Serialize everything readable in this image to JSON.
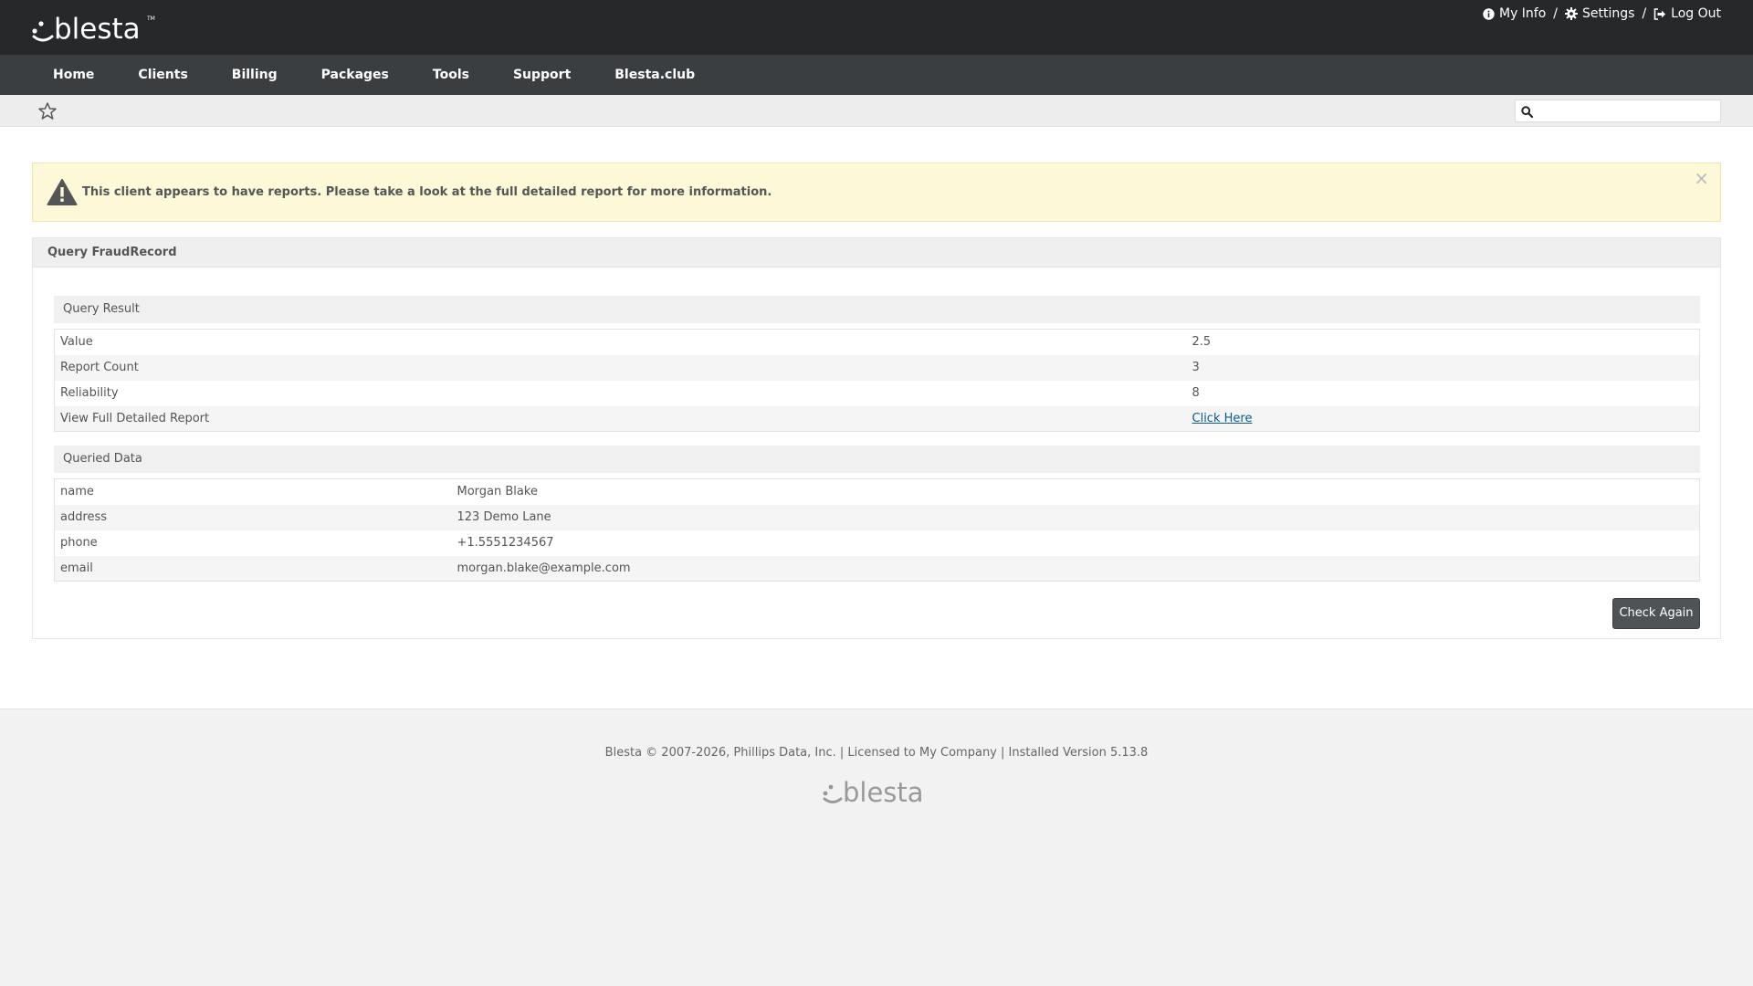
{
  "brand": {
    "logo_text": "blesta",
    "tm": "TM"
  },
  "user_links": [
    {
      "label": "My Info",
      "icon": "info-icon"
    },
    {
      "label": "Settings",
      "icon": "gear-icon"
    },
    {
      "label": "Log Out",
      "icon": "logout-icon"
    }
  ],
  "user_links_separator": "/",
  "nav": [
    "Home",
    "Clients",
    "Billing",
    "Packages",
    "Tools",
    "Support",
    "Blesta.club"
  ],
  "search": {
    "placeholder": "",
    "icon": "search-icon"
  },
  "alert": {
    "message": "This client appears to have reports. Please take a look at the full detailed report for more information.",
    "close": "×",
    "icon": "warning-icon"
  },
  "panel": {
    "title": "Query FraudRecord",
    "query_result": {
      "title": "Query Result",
      "rows": [
        {
          "label": "Value",
          "value": "2.5"
        },
        {
          "label": "Report Count",
          "value": "3"
        },
        {
          "label": "Reliability",
          "value": "8"
        },
        {
          "label": "View Full Detailed Report",
          "value": "Click Here"
        }
      ]
    },
    "queried_data": {
      "title": "Queried Data",
      "rows": [
        {
          "label": "name",
          "value": "Morgan Blake"
        },
        {
          "label": "address",
          "value": "123 Demo Lane"
        },
        {
          "label": "phone",
          "value": "+1.5551234567"
        },
        {
          "label": "email",
          "value": "morgan.blake@example.com"
        }
      ]
    },
    "check_again": "Check Again"
  },
  "footer": {
    "text": "Blesta © 2007-2026, Phillips Data, Inc. | Licensed to My Company | Installed Version 5.13.8",
    "logo_text": "blesta"
  },
  "colors": {
    "topbar": "#262829",
    "nav": "#3b3e40",
    "alert_bg": "#fcf8d8",
    "link": "#0c5a91",
    "button": "#505355"
  }
}
